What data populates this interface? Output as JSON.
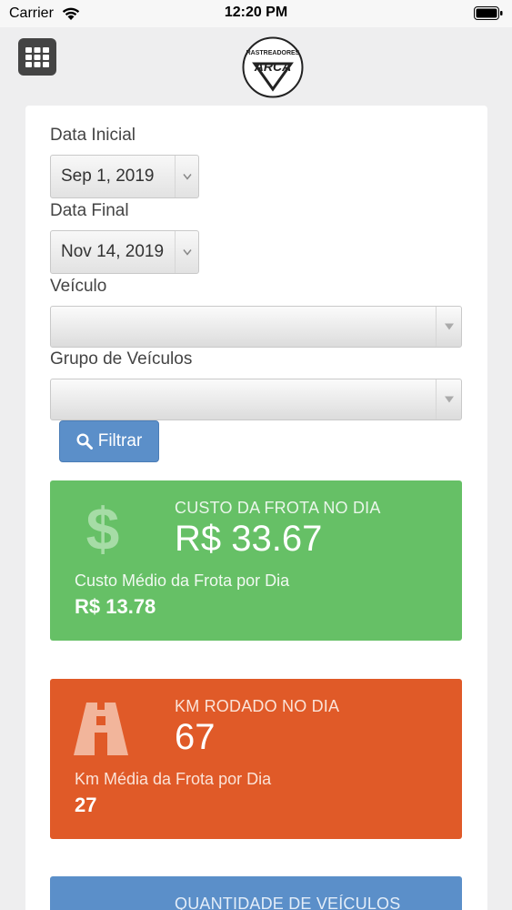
{
  "status_bar": {
    "carrier": "Carrier",
    "time": "12:20 PM"
  },
  "header": {
    "logo_text_top": "RASTREADORES",
    "logo_text_main": "ARCA"
  },
  "form": {
    "start_label": "Data Inicial",
    "start_value": "Sep 1, 2019",
    "end_label": "Data Final",
    "end_value": "Nov 14, 2019",
    "vehicle_label": "Veículo",
    "vehicle_value": "",
    "group_label": "Grupo de Veículos",
    "group_value": "",
    "filter_label": "Filtrar"
  },
  "panels": {
    "cost": {
      "title": "CUSTO DA FROTA NO DIA",
      "value": "R$ 33.67",
      "sub_label": "Custo Médio da Frota por Dia",
      "sub_value": "R$ 13.78",
      "icon": "dollar-icon",
      "color": "#66c066"
    },
    "km": {
      "title": "KM RODADO NO DIA",
      "value": "67",
      "sub_label": "Km Média da Frota por Dia",
      "sub_value": "27",
      "icon": "road-icon",
      "color": "#e05a28"
    },
    "vehicles": {
      "title": "QUANTIDADE DE VEÍCULOS",
      "color": "#5b8fc9"
    }
  }
}
